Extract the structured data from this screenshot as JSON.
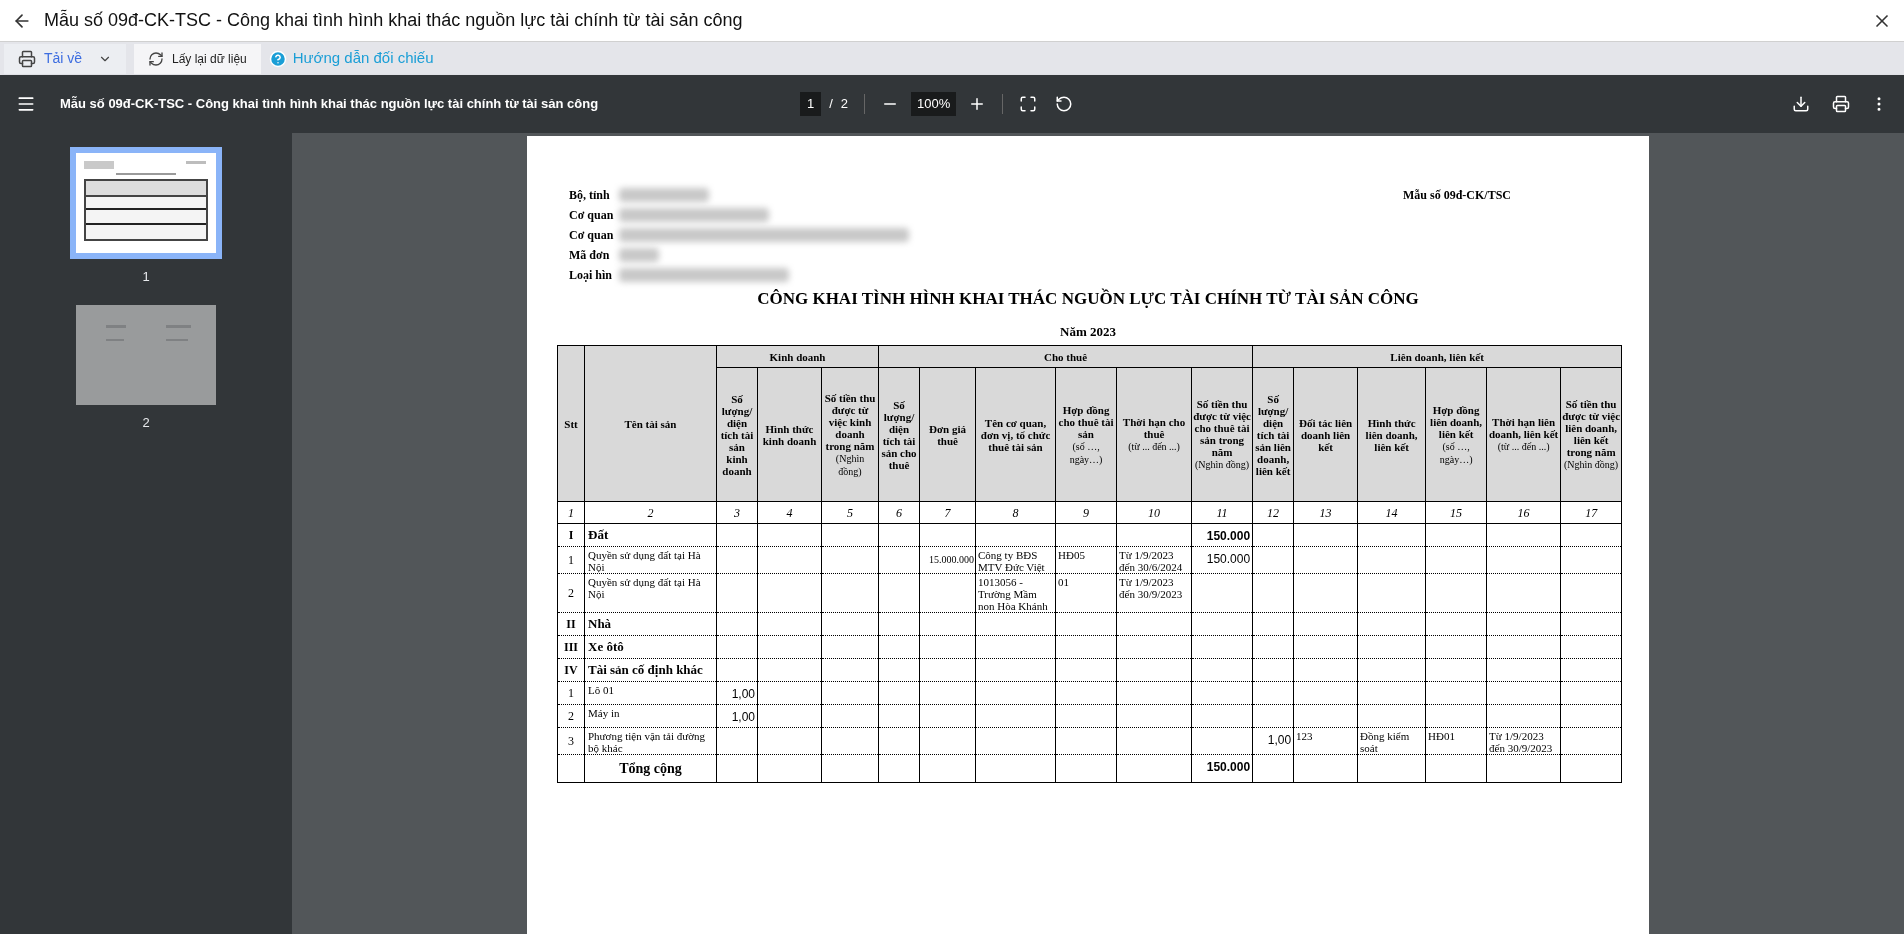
{
  "window": {
    "title": "Mẫu số 09đ-CK-TSC - Công khai tình hình khai thác nguồn lực tài chính từ tài sản công"
  },
  "toolbar": {
    "download": "Tải về",
    "reload": "Lấy lại dữ liệu",
    "guide": "Hướng dẫn đối chiếu"
  },
  "viewer": {
    "title": "Mẫu số 09đ-CK-TSC - Công khai tình hình khai thác nguồn lực tài chính từ tài sản công",
    "page": "1",
    "separator": "/",
    "page_count": "2",
    "zoom": "100%"
  },
  "thumbnails": [
    {
      "label": "1",
      "selected": true
    },
    {
      "label": "2",
      "selected": false
    }
  ],
  "document": {
    "header_fields": [
      "Bộ, tỉnh",
      "Cơ quan",
      "Cơ quan",
      "Mã đơn",
      "Loại hìn"
    ],
    "form_code": "Mẫu số 09đ-CK/TSC",
    "title": "CÔNG KHAI TÌNH HÌNH KHAI THÁC NGUỒN LỰC TÀI CHÍNH TỪ TÀI SẢN CÔNG",
    "year": "Năm 2023",
    "table": {
      "columns": [
        {
          "label": "Stt"
        },
        {
          "label": "Tên tài sản"
        },
        {
          "label": "Kinh doanh",
          "children": [
            {
              "label": "Số lượng/ diện tích tài sản kinh doanh"
            },
            {
              "label": "Hình thức kinh doanh"
            },
            {
              "label": "Số tiền thu được từ việc kinh doanh trong năm",
              "note": "(Nghìn đồng)"
            }
          ]
        },
        {
          "label": "Cho thuê",
          "children": [
            {
              "label": "Số lượng/ diện tích tài sản cho thuê"
            },
            {
              "label": "Đơn giá thuê"
            },
            {
              "label": "Tên cơ quan, đơn vị, tổ chức thuê tài sản"
            },
            {
              "label": "Hợp đồng cho thuê tài sản",
              "note": "(số …, ngày…)"
            },
            {
              "label": "Thời hạn cho thuê",
              "note": "(từ ... đến ...)"
            },
            {
              "label": "Số tiền thu được từ việc cho thuê tài sản trong năm",
              "note": "(Nghìn đồng)"
            }
          ]
        },
        {
          "label": "Liên doanh, liên kết",
          "children": [
            {
              "label": "Số lượng/ diện tích tài sản liên doanh, liên kết"
            },
            {
              "label": "Đối tác liên doanh liên kết"
            },
            {
              "label": "Hình thức liên doanh, liên kết"
            },
            {
              "label": "Hợp đồng liên doanh, liên kết",
              "note": "(số …, ngày…)"
            },
            {
              "label": "Thời hạn liên doanh, liên kết",
              "note": "(từ ... đến ...)"
            },
            {
              "label": "Số tiền thu được từ việc liên doanh, liên kết trong năm",
              "note": "(Nghìn đồng)"
            }
          ]
        }
      ],
      "column_numbers": [
        "1",
        "2",
        "3",
        "4",
        "5",
        "6",
        "7",
        "8",
        "9",
        "10",
        "11",
        "12",
        "13",
        "14",
        "15",
        "16",
        "17"
      ],
      "rows": [
        {
          "kind": "section",
          "stt": "I",
          "name": "Đất",
          "cells": {
            "11": {
              "kind": "amount",
              "text": "150.000"
            }
          }
        },
        {
          "kind": "item",
          "stt": "1",
          "name": "Quyền sử dụng đất tại Hà Nội",
          "cells": {
            "7": {
              "kind": "price",
              "text": "15.000.000"
            },
            "8": {
              "text": "Công ty BĐS MTV Đức Việt"
            },
            "9": {
              "text": "HĐ05"
            },
            "10": {
              "text": "Từ 1/9/2023 đến 30/6/2024"
            },
            "11": {
              "kind": "amount",
              "text": "150.000"
            }
          }
        },
        {
          "kind": "item",
          "stt": "2",
          "name": "Quyền sử dụng đất tại Hà Nội",
          "cells": {
            "8": {
              "text": "1013056 - Trường Mầm non Hòa Khánh"
            },
            "9": {
              "text": "01"
            },
            "10": {
              "text": "Từ 1/9/2023 đến 30/9/2023"
            }
          }
        },
        {
          "kind": "section",
          "stt": "II",
          "name": "Nhà",
          "cells": {}
        },
        {
          "kind": "section",
          "stt": "III",
          "name": "Xe ôtô",
          "cells": {}
        },
        {
          "kind": "section",
          "stt": "IV",
          "name": "Tài sản cố định khác",
          "cells": {}
        },
        {
          "kind": "item",
          "stt": "1",
          "name": "Lô 01",
          "cells": {
            "3": {
              "kind": "amount",
              "text": "1,00"
            }
          }
        },
        {
          "kind": "item",
          "stt": "2",
          "name": "Máy in",
          "cells": {
            "3": {
              "kind": "amount",
              "text": "1,00"
            }
          }
        },
        {
          "kind": "item",
          "stt": "3",
          "name": "Phương tiện vận tải đường bộ khác",
          "cells": {
            "12": {
              "kind": "amount",
              "text": "1,00"
            },
            "13": {
              "text": "123"
            },
            "14": {
              "text": "Đồng kiểm soát"
            },
            "15": {
              "text": "HĐ01"
            },
            "16": {
              "text": "Từ 1/9/2023 đến 30/9/2023"
            }
          }
        },
        {
          "kind": "total",
          "name": "Tổng cộng",
          "cells": {
            "11": {
              "kind": "amount",
              "text": "150.000"
            }
          }
        }
      ]
    }
  }
}
